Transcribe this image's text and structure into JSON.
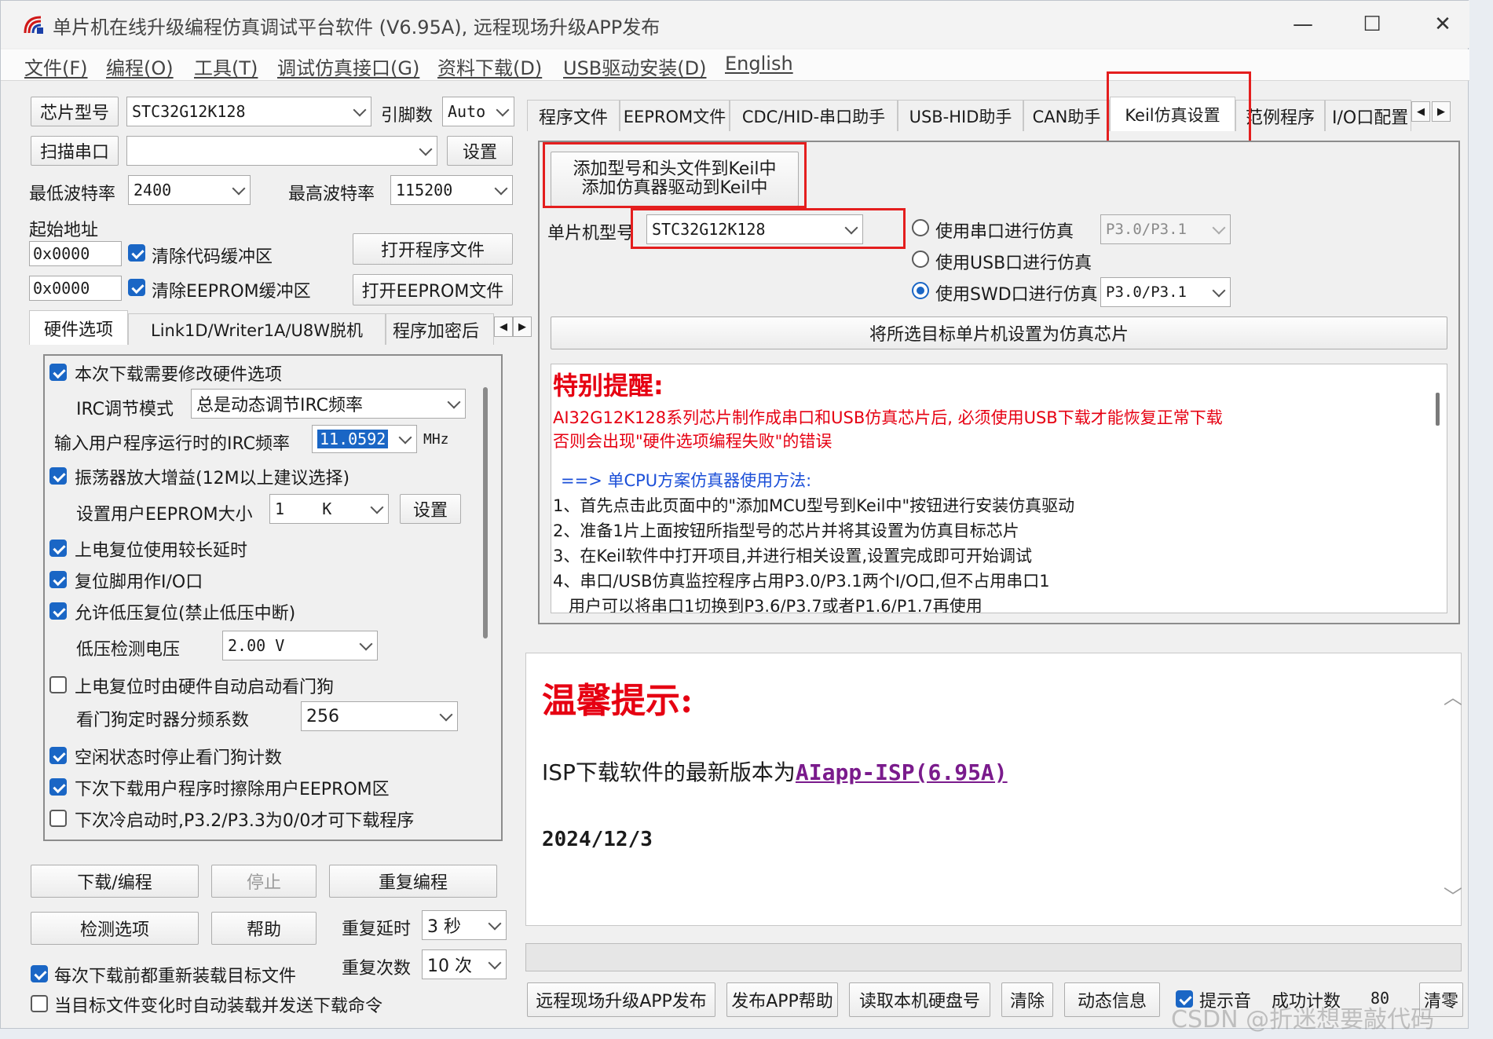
{
  "window": {
    "title": "单片机在线升级编程仿真调试平台软件 (V6.95A), 远程现场升级APP发布",
    "minimize": "—",
    "maximize": "☐",
    "close": "✕"
  },
  "menu": [
    "文件(F)",
    "编程(O)",
    "工具(T)",
    "调试仿真接口(G)",
    "资料下载(D)",
    "USB驱动安装(D)",
    "English"
  ],
  "left": {
    "chip_btn": "芯片型号",
    "chip_value": "STC32G12K128",
    "pin_label": "引脚数",
    "pin_value": "Auto",
    "scan_btn": "扫描串口",
    "port_value": "",
    "settings_btn": "设置",
    "min_baud_label": "最低波特率",
    "min_baud_value": "2400",
    "max_baud_label": "最高波特率",
    "max_baud_value": "115200",
    "start_addr_label": "起始地址",
    "addr1": "0x0000",
    "clear_code": "清除代码缓冲区",
    "open_prog": "打开程序文件",
    "addr2": "0x0000",
    "clear_eeprom": "清除EEPROM缓冲区",
    "open_eeprom": "打开EEPROM文件",
    "tabs": [
      "硬件选项",
      "Link1D/Writer1A/U8W脱机",
      "程序加密后"
    ],
    "hw": {
      "opt1": "本次下载需要修改硬件选项",
      "irc_mode_label": "IRC调节模式",
      "irc_mode_value": "总是动态调节IRC频率",
      "irc_freq_label": "输入用户程序运行时的IRC频率",
      "irc_freq_value": "11.0592",
      "irc_unit": "MHz",
      "opt2": "振荡器放大增益(12M以上建议选择)",
      "eeprom_size_label": "设置用户EEPROM大小",
      "eeprom_size_value": "1    K",
      "eeprom_set_btn": "设置",
      "opt3": "上电复位使用较长延时",
      "opt4": "复位脚用作I/O口",
      "opt5": "允许低压复位(禁止低压中断)",
      "lvd_label": "低压检测电压",
      "lvd_value": "2.00 V",
      "opt6": "上电复位时由硬件自动启动看门狗",
      "wdt_label": "看门狗定时器分频系数",
      "wdt_value": "256",
      "opt7": "空闲状态时停止看门狗计数",
      "opt8": "下次下载用户程序时擦除用户EEPROM区",
      "opt9": "下次冷启动时,P3.2/P3.3为0/0才可下载程序"
    },
    "download_btn": "下载/编程",
    "stop_btn": "停止",
    "repeat_btn": "重复编程",
    "check_btn": "检测选项",
    "help_btn": "帮助",
    "repeat_delay_label": "重复延时",
    "repeat_delay_value": "3 秒",
    "repeat_count_label": "重复次数",
    "repeat_count_value": "10 次",
    "reload_each": "每次下载前都重新装载目标文件",
    "auto_reload": "当目标文件变化时自动装载并发送下载命令"
  },
  "right": {
    "tabs": [
      "程序文件",
      "EEPROM文件",
      "CDC/HID-串口助手",
      "USB-HID助手",
      "CAN助手",
      "Keil仿真设置",
      "范例程序",
      "I/O口配置"
    ],
    "add_btn_line1": "添加型号和头文件到Keil中",
    "add_btn_line2": "添加仿真器驱动到Keil中",
    "mcu_label": "单片机型号",
    "mcu_value": "STC32G12K128",
    "radio1": "使用串口进行仿真",
    "radio1_port": "P3.0/P3.1",
    "radio2": "使用USB口进行仿真",
    "radio3": "使用SWD口进行仿真",
    "radio3_port": "P3.0/P3.1",
    "set_target_btn": "将所选目标单片机设置为仿真芯片",
    "notice_title": "特别提醒:",
    "notice_l1": "AI32G12K128系列芯片制作成串口和USB仿真芯片后, 必须使用USB下载才能恢复正常下载",
    "notice_l2": "否则会出现\"硬件选项编程失败\"的错误",
    "method_title": "==> 单CPU方案仿真器使用方法:",
    "step1": "1、首先点击此页面中的\"添加MCU型号到Keil中\"按钮进行安装仿真驱动",
    "step2": "2、准备1片上面按钮所指型号的芯片并将其设置为仿真目标芯片",
    "step3": "3、在Keil软件中打开项目,并进行相关设置,设置完成即可开始调试",
    "step4": "4、串口/USB仿真监控程序占用P3.0/P3.1两个I/O口,但不占用串口1",
    "step5": "   用户可以将串口1切换到P3.6/P3.7或者P1.6/P1.7再使用",
    "tip_title": "温馨提示:",
    "isp_text": "ISP下载软件的最新版本为",
    "isp_link": "AIapp-ISP(6.95A)",
    "date": "2024/12/3",
    "bottom_buttons": [
      "远程现场升级APP发布",
      "发布APP帮助",
      "读取本机硬盘号",
      "清除",
      "动态信息"
    ],
    "sound_label": "提示音",
    "success_label": "成功计数",
    "success_value": "80",
    "clear_btn": "清零"
  },
  "watermark": "CSDN @折迷想要敲代码",
  "colors": {
    "accent": "#1a66c5",
    "highlight": "#e41e1e",
    "link": "#7a1b8c"
  }
}
